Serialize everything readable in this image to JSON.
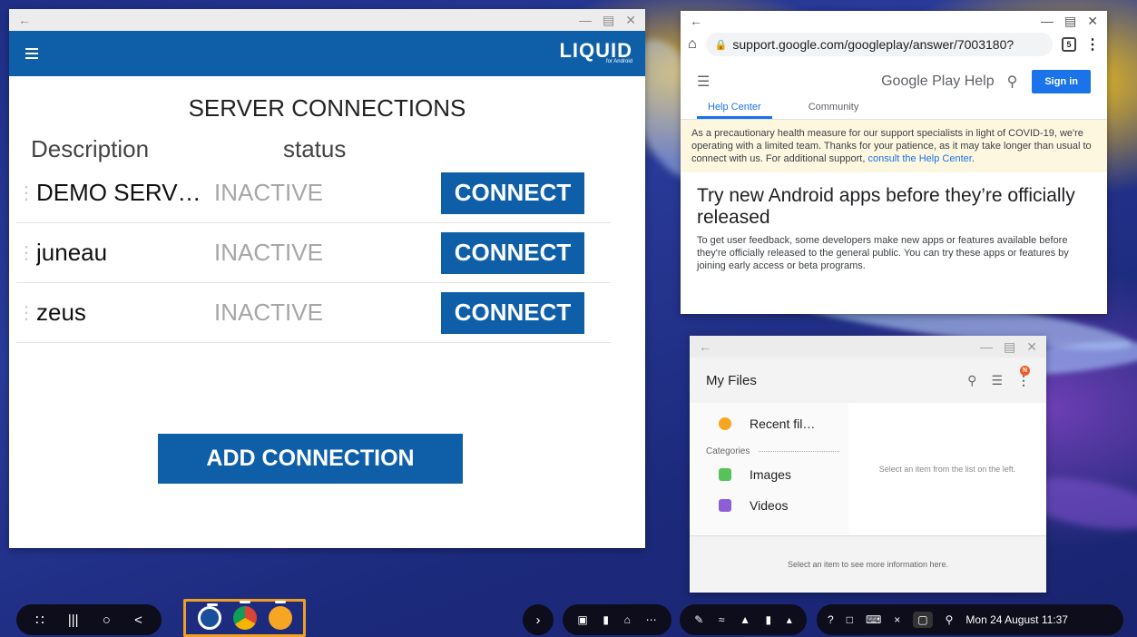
{
  "liquid": {
    "logo": "LIQUID",
    "logo_sub": "for Android",
    "heading": "SERVER CONNECTIONS",
    "col_description": "Description",
    "col_status": "status",
    "connections": [
      {
        "name": "DEMO SERV…",
        "status": "INACTIVE",
        "action": "CONNECT"
      },
      {
        "name": "juneau",
        "status": "INACTIVE",
        "action": "CONNECT"
      },
      {
        "name": "zeus",
        "status": "INACTIVE",
        "action": "CONNECT"
      }
    ],
    "add_button": "ADD CONNECTION"
  },
  "chrome": {
    "url": "support.google.com/googleplay/answer/7003180?",
    "tab_count": "5",
    "site_title": "Google Play Help",
    "sign_in": "Sign in",
    "tabs": [
      "Help Center",
      "Community"
    ],
    "notice": "As a precautionary health measure for our support specialists in light of COVID-19, we're operating with a limited team. Thanks for your patience, as it may take longer than usual to connect with us. For additional support,",
    "notice_link": "consult the Help Center",
    "notice_end": ".",
    "article_title": "Try new Android apps before they’re officially released",
    "article_body": "To get user feedback, some developers make new apps or features available before they're officially released to the general public. You can try these apps or features by joining early access or beta programs."
  },
  "files": {
    "title": "My Files",
    "badge": "N",
    "recent": "Recent fil…",
    "categories": "Categories",
    "images": "Images",
    "videos": "Videos",
    "pane_hint": "Select an item from the list on the left.",
    "footer_hint": "Select an item to see more information here."
  },
  "taskbar": {
    "datetime": "Mon 24 August 11:37"
  },
  "colors": {
    "liquid_blue": "#0e5fa8",
    "google_blue": "#1a73e8",
    "taskbar_highlight": "#f0a020"
  }
}
